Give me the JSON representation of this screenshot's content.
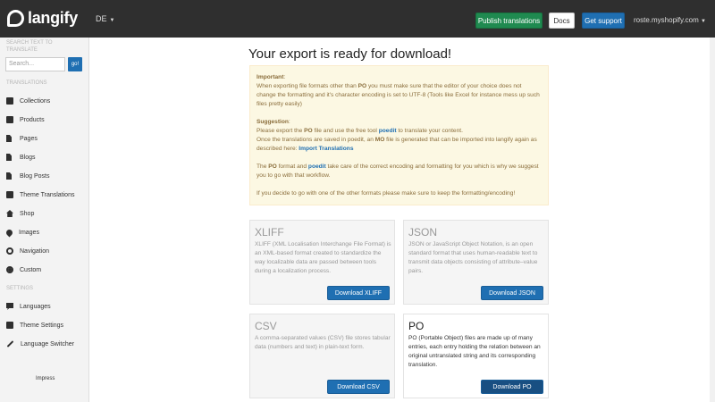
{
  "header": {
    "logo_text": "langify",
    "language": "DE",
    "publish_label": "Publish translations",
    "docs_label": "Docs",
    "support_label": "Get support",
    "shop": "roste.myshopify.com"
  },
  "sidebar": {
    "search_heading": "SEARCH TEXT TO TRANSLATE",
    "search_placeholder": "Search...",
    "search_button": "go!",
    "translations_heading": "TRANSLATIONS",
    "items": [
      {
        "label": "Collections",
        "icon": "folder-icon"
      },
      {
        "label": "Products",
        "icon": "book-icon"
      },
      {
        "label": "Pages",
        "icon": "page-icon"
      },
      {
        "label": "Blogs",
        "icon": "blog-icon"
      },
      {
        "label": "Blog Posts",
        "icon": "blog-post-icon"
      },
      {
        "label": "Theme Translations",
        "icon": "image-icon"
      },
      {
        "label": "Shop",
        "icon": "home-icon"
      },
      {
        "label": "Images",
        "icon": "drop-icon"
      },
      {
        "label": "Navigation",
        "icon": "link-icon"
      },
      {
        "label": "Custom",
        "icon": "gear-icon"
      }
    ],
    "settings_heading": "SETTINGS",
    "settings_items": [
      {
        "label": "Languages",
        "icon": "speech-bubble-icon"
      },
      {
        "label": "Theme Settings",
        "icon": "image-icon"
      },
      {
        "label": "Language Switcher",
        "icon": "pencil-icon"
      }
    ],
    "impressum": "Impress"
  },
  "main": {
    "title": "Your export is ready for download!",
    "notice": {
      "important_label": "Important",
      "important_pre": "When exporting file formats other than ",
      "important_po": "PO",
      "important_post": " you must make sure that the editor of your choice does not change the formatting and it's character encoding is set to UTF-8 (Tools like Excel for instance mess up such files pretty easily)",
      "suggestion_label": "Suggestion",
      "s1_pre": "Please export the ",
      "s1_po": "PO",
      "s1_mid": " file and use the free tool ",
      "s1_tool": "poedit",
      "s1_post": " to translate your content.",
      "s2_pre": "Once the translations are saved in poedit, an ",
      "s2_mo": "MO",
      "s2_post": " file is generated that can be imported into langify again as described here: ",
      "s2_link": "Import Translations",
      "p3_pre": "The ",
      "p3_po": "PO",
      "p3_mid": " format and ",
      "p3_tool": "poedit",
      "p3_post": " take care of the correct encoding and formatting for you which is why we suggest you to go with that workflow.",
      "p4": "If you decide to go with one of the other formats please make sure to keep the formatting/encoding!"
    },
    "formats": [
      {
        "title": "XLIFF",
        "description": "XLIFF (XML Localisation Interchange File Format) is an XML-based format created to standardize the way localizable data are passed between tools during a localization process.",
        "button": "Download XLIFF"
      },
      {
        "title": "JSON",
        "description": "JSON or JavaScript Object Notation, is an open standard format that uses human-readable text to transmit data objects consisting of attribute–value pairs.",
        "button": "Download JSON"
      },
      {
        "title": "CSV",
        "description": "A comma-separated values (CSV) file stores tabular data (numbers and text) in plain-text form.",
        "button": "Download CSV"
      },
      {
        "title": "PO",
        "description": "PO (Portable Object) files are made up of many entries, each entry holding the relation between an original untranslated string and its corresponding translation.",
        "button": "Download PO"
      }
    ]
  }
}
